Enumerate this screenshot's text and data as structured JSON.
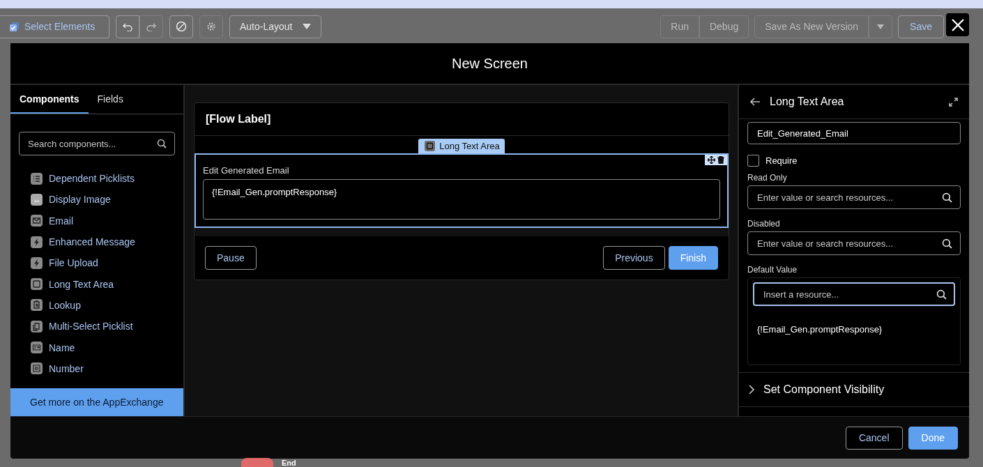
{
  "toolbar": {
    "select_button": {
      "label": "Select Elements"
    },
    "undo": {
      "disabled": false
    },
    "redo": {
      "disabled": true
    },
    "clear": {
      "disabled": false
    },
    "settings": {
      "disabled": true
    },
    "layout_dropdown": {
      "value": "Auto-Layout"
    },
    "actions": [
      {
        "label": "Run",
        "disabled": true
      },
      {
        "label": "Debug",
        "disabled": true
      },
      {
        "label": "Save As New Version",
        "disabled": true,
        "menu": true
      },
      {
        "label": "Save",
        "disabled": false
      }
    ]
  },
  "modal": {
    "title": "New Screen",
    "tabs": [
      {
        "label": "Components",
        "selected": true
      },
      {
        "label": "Fields",
        "selected": false
      }
    ],
    "search": {
      "placeholder": "Search components..."
    },
    "components": [
      {
        "kind": "list",
        "label": "Dependent Picklists"
      },
      {
        "kind": "image",
        "label": "Display Image"
      },
      {
        "kind": "email",
        "label": "Email"
      },
      {
        "kind": "bolt",
        "label": "Enhanced Message"
      },
      {
        "kind": "bolt",
        "label": "File Upload"
      },
      {
        "kind": "textarea",
        "label": "Long Text Area"
      },
      {
        "kind": "lookup",
        "label": "Lookup"
      },
      {
        "kind": "multi",
        "label": "Multi-Select Picklist"
      },
      {
        "kind": "name",
        "label": "Name"
      },
      {
        "kind": "number",
        "label": "Number"
      }
    ],
    "appexchange": "Get more on the AppExchange",
    "canvas": {
      "flow_label": "[Flow Label]",
      "component_tag": "Long Text Area",
      "field_label": "Edit Generated Email",
      "field_value": "{!Email_Gen.promptResponse}",
      "buttons": [
        {
          "label": "Pause",
          "kind": "neutral"
        },
        {
          "label": "Previous",
          "kind": "neutral"
        },
        {
          "label": "Finish",
          "kind": "brand"
        }
      ]
    },
    "properties": {
      "title": "Long Text Area",
      "api_name": "Edit_Generated_Email",
      "require": {
        "label": "Require",
        "checked": false
      },
      "read_only": {
        "label": "Read Only",
        "placeholder": "Enter value or search resources..."
      },
      "disabled": {
        "label": "Disabled",
        "placeholder": "Enter value or search resources..."
      },
      "default_value": {
        "label": "Default Value",
        "placeholder": "Insert a resource...",
        "value": "{!Email_Gen.promptResponse}"
      },
      "section": {
        "label": "Set Component Visibility",
        "expanded": false
      }
    },
    "footer": [
      {
        "label": "Cancel",
        "kind": "neutral"
      },
      {
        "label": "Done",
        "kind": "brand"
      }
    ]
  },
  "background_node": {
    "label": "End"
  }
}
